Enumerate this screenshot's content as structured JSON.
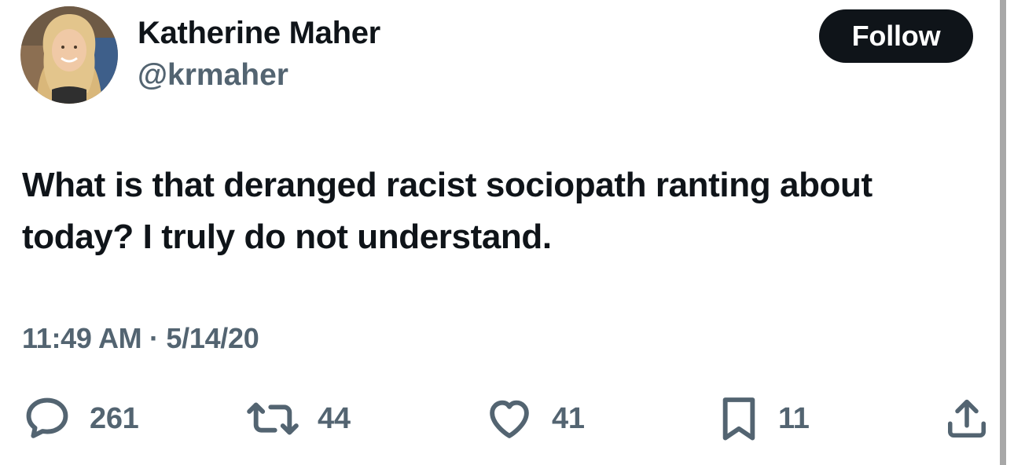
{
  "author": {
    "display_name": "Katherine Maher",
    "handle": "@krmaher"
  },
  "follow_label": "Follow",
  "tweet": {
    "text": "What is that deranged racist sociopath ranting about today? I truly do not understand.",
    "timestamp": "11:49 AM · 5/14/20"
  },
  "actions": {
    "replies": "261",
    "reposts": "44",
    "likes": "41",
    "bookmarks": "11"
  },
  "icons": {
    "reply": "speech-bubble-icon",
    "repost": "repost-arrows-icon",
    "like": "heart-icon",
    "bookmark": "bookmark-icon",
    "share": "share-upload-icon"
  },
  "colors": {
    "text_primary": "#0f1419",
    "text_secondary": "#536471",
    "button_bg": "#0f1419",
    "button_text": "#ffffff"
  }
}
